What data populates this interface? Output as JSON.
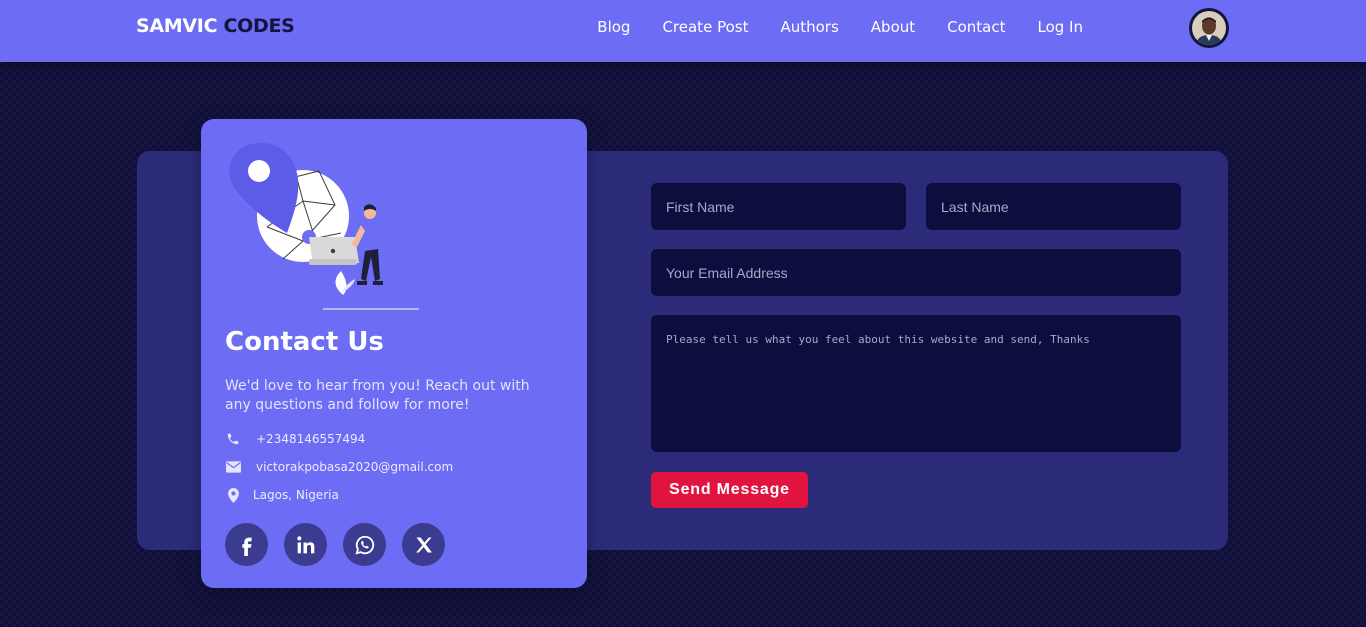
{
  "navbar": {
    "brand_part1": "SAMVIC",
    "brand_part2": " CODES",
    "links": [
      "Blog",
      "Create Post",
      "Authors",
      "About",
      "Contact",
      "Log In"
    ],
    "avatar_icon": "user-avatar"
  },
  "contact_card": {
    "title": "Contact Us",
    "description": "We'd love to hear from you! Reach out with any questions and follow for more!",
    "phone": "+2348146557494",
    "email": "victorakpobasa2020@gmail.com",
    "location": "Lagos, Nigeria",
    "icons": {
      "phone": "phone-icon",
      "email": "envelope-icon",
      "location": "map-pin-icon"
    },
    "socials": [
      "facebook-icon",
      "linkedin-icon",
      "whatsapp-icon",
      "x-icon"
    ]
  },
  "form": {
    "first_name_placeholder": "First Name",
    "last_name_placeholder": "Last Name",
    "email_placeholder": "Your Email Address",
    "message_placeholder": "Please tell us what you feel about this website and send, Thanks",
    "send_label": "Send Message"
  },
  "colors": {
    "nav_bg": "#6c6cf5",
    "page_bg": "#0f0f3a",
    "panel_bg": "#2b2b7a",
    "card_bg": "#6c6cf5",
    "input_bg": "#0d0d3e",
    "send_button": "#e0143e",
    "brand_dark": "#14143c"
  }
}
